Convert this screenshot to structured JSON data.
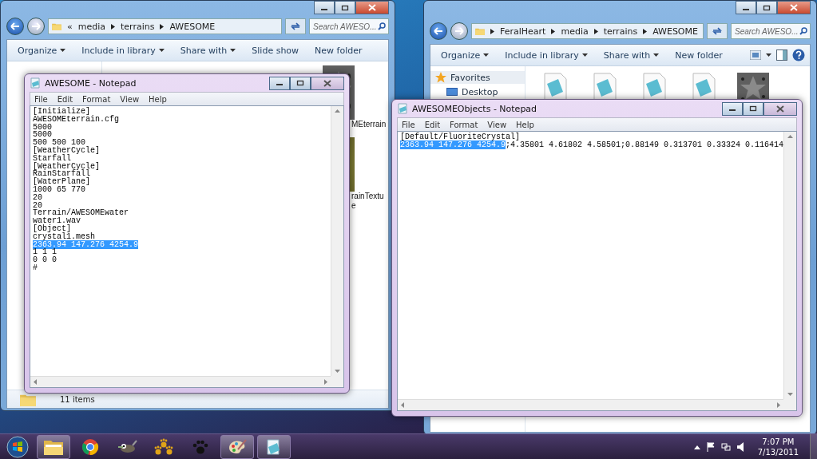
{
  "explorers": [
    {
      "breadcrumb": [
        {
          "label": "«",
          "kind": "overflow"
        },
        {
          "label": "media",
          "kind": "folder"
        },
        {
          "label": "terrains",
          "kind": "folder"
        },
        {
          "label": "AWESOME",
          "kind": "folder"
        }
      ],
      "search": {
        "placeholder": "Search AWESO..."
      },
      "toolbar": [
        {
          "label": "Organize",
          "dropdown": true
        },
        {
          "label": "Include in library",
          "dropdown": true
        },
        {
          "label": "Share with",
          "dropdown": true
        },
        {
          "label": "Slide show",
          "dropdown": false
        },
        {
          "label": "New folder",
          "dropdown": false
        }
      ],
      "files": [
        {
          "kind": "star-image",
          "lines": [
            "MEterrain"
          ]
        },
        {
          "kind": "texture",
          "lines": [
            "rainTextu",
            "e"
          ]
        }
      ],
      "status": "11 items"
    },
    {
      "breadcrumb": [
        {
          "label": "FeralHeart",
          "kind": "folder"
        },
        {
          "label": "media",
          "kind": "folder"
        },
        {
          "label": "terrains",
          "kind": "folder"
        },
        {
          "label": "AWESOME",
          "kind": "folder"
        }
      ],
      "search": {
        "placeholder": "Search AWESO..."
      },
      "toolbar": [
        {
          "label": "Organize",
          "dropdown": true
        },
        {
          "label": "Include in library",
          "dropdown": true
        },
        {
          "label": "Share with",
          "dropdown": true
        },
        {
          "label": "New folder",
          "dropdown": false
        }
      ],
      "nav": [
        {
          "label": "Favorites",
          "kind": "star"
        },
        {
          "label": "Desktop",
          "kind": "desktop"
        }
      ],
      "files": [
        {
          "kind": "document"
        },
        {
          "kind": "document"
        },
        {
          "kind": "document"
        },
        {
          "kind": "document"
        },
        {
          "kind": "star-image"
        }
      ]
    }
  ],
  "notepads": [
    {
      "title": "AWESOME - Notepad",
      "menu": [
        "File",
        "Edit",
        "Format",
        "View",
        "Help"
      ],
      "lines": [
        [
          {
            "text": "[Initialize]",
            "selected": false
          }
        ],
        [
          {
            "text": "AWESOMEterrain.cfg",
            "selected": false
          }
        ],
        [
          {
            "text": "5000",
            "selected": false
          }
        ],
        [
          {
            "text": "5000",
            "selected": false
          }
        ],
        [
          {
            "text": "500 500 100",
            "selected": false
          }
        ],
        [
          {
            "text": "[WeatherCycle]",
            "selected": false
          }
        ],
        [
          {
            "text": "Starfall",
            "selected": false
          }
        ],
        [
          {
            "text": "[WeatherCycle]",
            "selected": false
          }
        ],
        [
          {
            "text": "RainStarfall",
            "selected": false
          }
        ],
        [
          {
            "text": "[WaterPlane]",
            "selected": false
          }
        ],
        [
          {
            "text": "1000 65 770",
            "selected": false
          }
        ],
        [
          {
            "text": "20",
            "selected": false
          }
        ],
        [
          {
            "text": "20",
            "selected": false
          }
        ],
        [
          {
            "text": "Terrain/AWESOMEwater",
            "selected": false
          }
        ],
        [
          {
            "text": "water1.wav",
            "selected": false
          }
        ],
        [
          {
            "text": "[Object]",
            "selected": false
          }
        ],
        [
          {
            "text": "crystal1.mesh",
            "selected": false
          }
        ],
        [
          {
            "text": "2363.94 147.276 4254.9",
            "selected": true
          }
        ],
        [
          {
            "text": "1 1 1",
            "selected": false
          }
        ],
        [
          {
            "text": "0 0 0",
            "selected": false
          }
        ],
        [
          {
            "text": "#",
            "selected": false
          }
        ]
      ]
    },
    {
      "title": "AWESOMEObjects - Notepad",
      "menu": [
        "File",
        "Edit",
        "Format",
        "View",
        "Help"
      ],
      "lines": [
        [
          {
            "text": "[Default/FluoriteCrystal]",
            "selected": false
          }
        ],
        [
          {
            "text": "2363.94 147.276 4254.9",
            "selected": true
          },
          {
            "text": ";4.35801 4.61802 4.58501;0.88149 0.313701 0.33324 0.116414",
            "selected": false
          }
        ]
      ]
    }
  ],
  "taskbar": {
    "items": [
      {
        "kind": "explorer",
        "open": true
      },
      {
        "kind": "browser",
        "open": false
      },
      {
        "kind": "wilber",
        "open": false
      },
      {
        "kind": "paw-cluster",
        "open": false
      },
      {
        "kind": "paw",
        "open": false
      },
      {
        "kind": "paint",
        "open": true
      },
      {
        "kind": "notepad",
        "open": true
      }
    ],
    "clock": {
      "time": "7:07 PM",
      "date": "7/13/2011"
    }
  }
}
